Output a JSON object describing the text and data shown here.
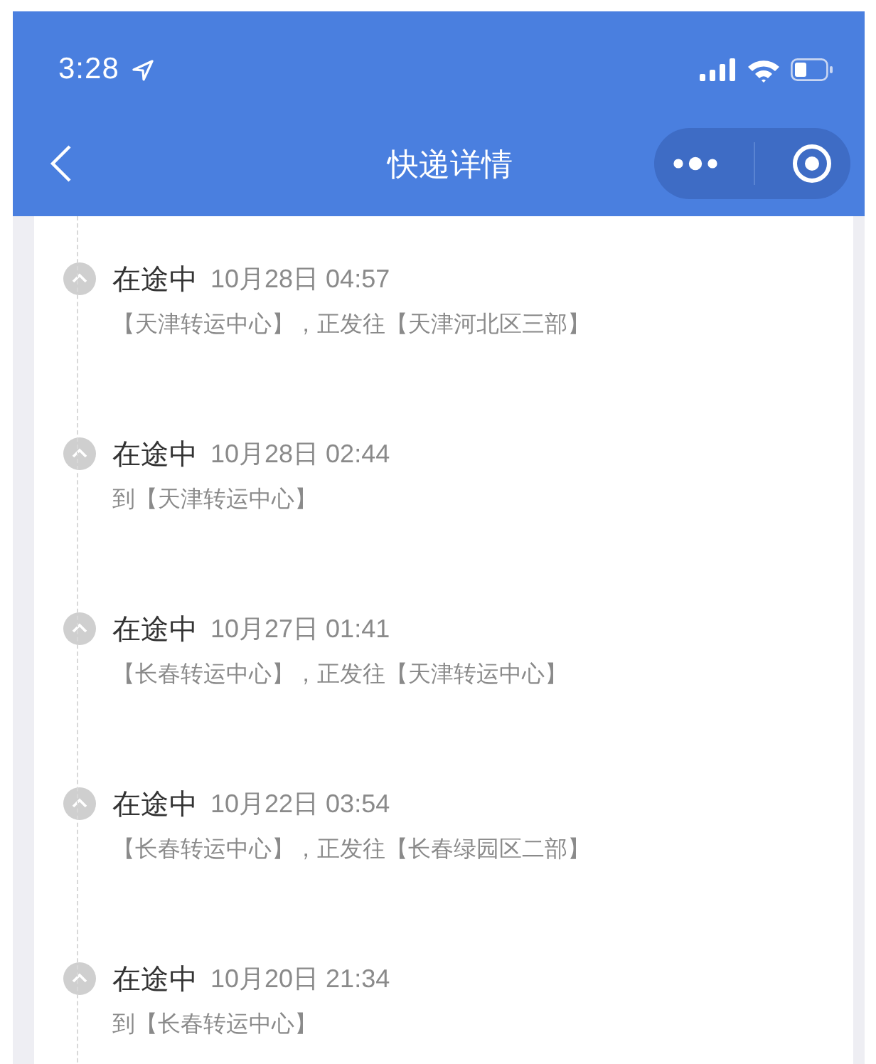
{
  "status_bar": {
    "time": "3:28"
  },
  "nav": {
    "title": "快递详情"
  },
  "events": [
    {
      "status": "在途中",
      "time": "10月28日 04:57",
      "detail": "【天津转运中心】，正发往【天津河北区三部】"
    },
    {
      "status": "在途中",
      "time": "10月28日 02:44",
      "detail": "到【天津转运中心】"
    },
    {
      "status": "在途中",
      "time": "10月27日 01:41",
      "detail": "【长春转运中心】，正发往【天津转运中心】"
    },
    {
      "status": "在途中",
      "time": "10月22日 03:54",
      "detail": "【长春转运中心】，正发往【长春绿园区二部】"
    },
    {
      "status": "在途中",
      "time": "10月20日 21:34",
      "detail": "到【长春转运中心】"
    }
  ]
}
